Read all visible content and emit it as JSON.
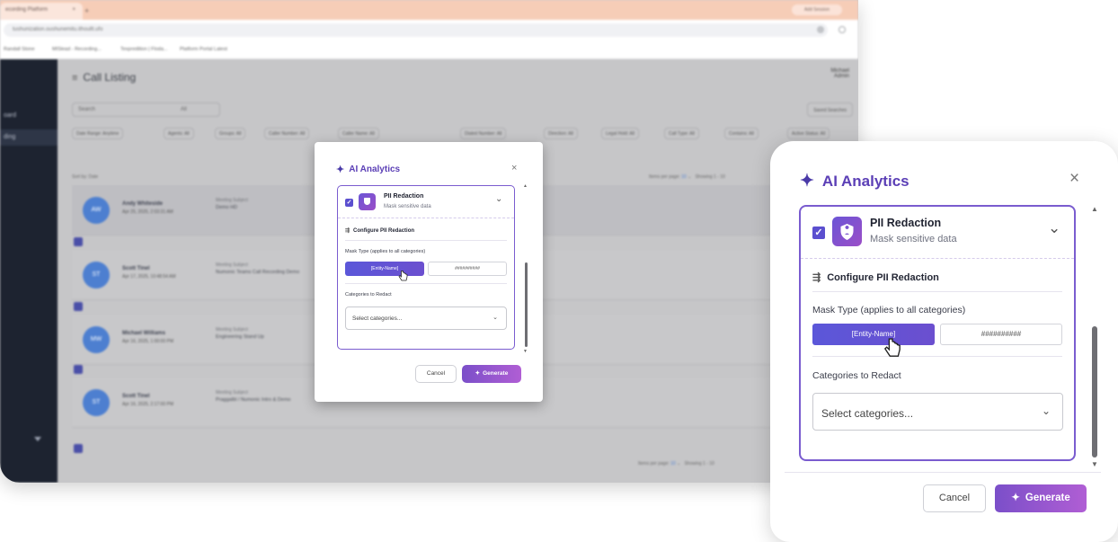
{
  "browser": {
    "tab_title": "ecording Platform",
    "tab_close": "×",
    "tab_new": "+",
    "top_right_button": "Add Session",
    "url": "tushunization.oushunemitu.ithoullt.ufo",
    "bookmarks": [
      "Randall Stone",
      "MISlead - Recording...",
      "Texpredition | Floda...",
      "Platform Portal Latest"
    ]
  },
  "app": {
    "page_title": "Call Listing",
    "user_name": "Michael",
    "user_role": "Admin",
    "sidebar_items": [
      "oard",
      "ding"
    ],
    "search_placeholder": "Search",
    "search_scope": "All",
    "saved_searches": "Saved Searches",
    "filters": [
      "Date Range: Anytime",
      "Agents: All",
      "Groups: All",
      "Caller Number: All",
      "Caller Name: All",
      "Dialed Number: All",
      "Direction: All",
      "Legal Hold: All",
      "Call Type: All",
      "Contains: All",
      "Active Status: All"
    ],
    "sort_label": "Sort by: Date",
    "items_per_page_label": "Items per page:",
    "items_per_page_value": "10",
    "showing": "Showing 1 - 10",
    "rows": [
      {
        "initials": "AW",
        "name": "Andy Whiteside",
        "date": "Apr 25, 2025, 2:03:31 AM",
        "subject_label": "Meeting Subject",
        "topic": "Demo HD"
      },
      {
        "initials": "ST",
        "name": "Scott Tinel",
        "date": "Apr 17, 2025, 10:48:54 AM",
        "subject_label": "Meeting Subject",
        "topic": "Numonic Teams Call Recording Demo"
      },
      {
        "initials": "MW",
        "name": "Michael Williams",
        "date": "Apr 16, 2025, 1:00:00 PM",
        "subject_label": "Meeting Subject",
        "topic": "Engineering Stand Up"
      },
      {
        "initials": "ST",
        "name": "Scott Tinel",
        "date": "Apr 16, 2025, 2:17:00 PM",
        "subject_label": "Meeting Subject",
        "topic": "Praggalbl / Numonic Intro & Demo"
      }
    ]
  },
  "modal": {
    "title": "AI Analytics",
    "close_glyph": "×",
    "feature_title": "PII Redaction",
    "feature_subtitle": "Mask sensitive data",
    "section_title": "Configure PII Redaction",
    "mask_type_label": "Mask Type (applies to all categories)",
    "mask_option_entity": "[Entity-Name]",
    "mask_option_hash": "##########",
    "categories_label": "Categories to Redact",
    "categories_placeholder": "Select categories...",
    "cancel_label": "Cancel",
    "generate_label": "Generate",
    "checkbox_glyph": "✓",
    "chevron_glyph": "⌄",
    "scroll_up_glyph": "▲",
    "scroll_down_glyph": "▼",
    "sparkle_glyph": "✦"
  },
  "colors": {
    "accent_purple": "#5b3fb6",
    "panel_border": "#7a5ccf",
    "generate_start": "#7b4fc9",
    "generate_end": "#b05ed4",
    "mask_button": "#5b57d9"
  }
}
